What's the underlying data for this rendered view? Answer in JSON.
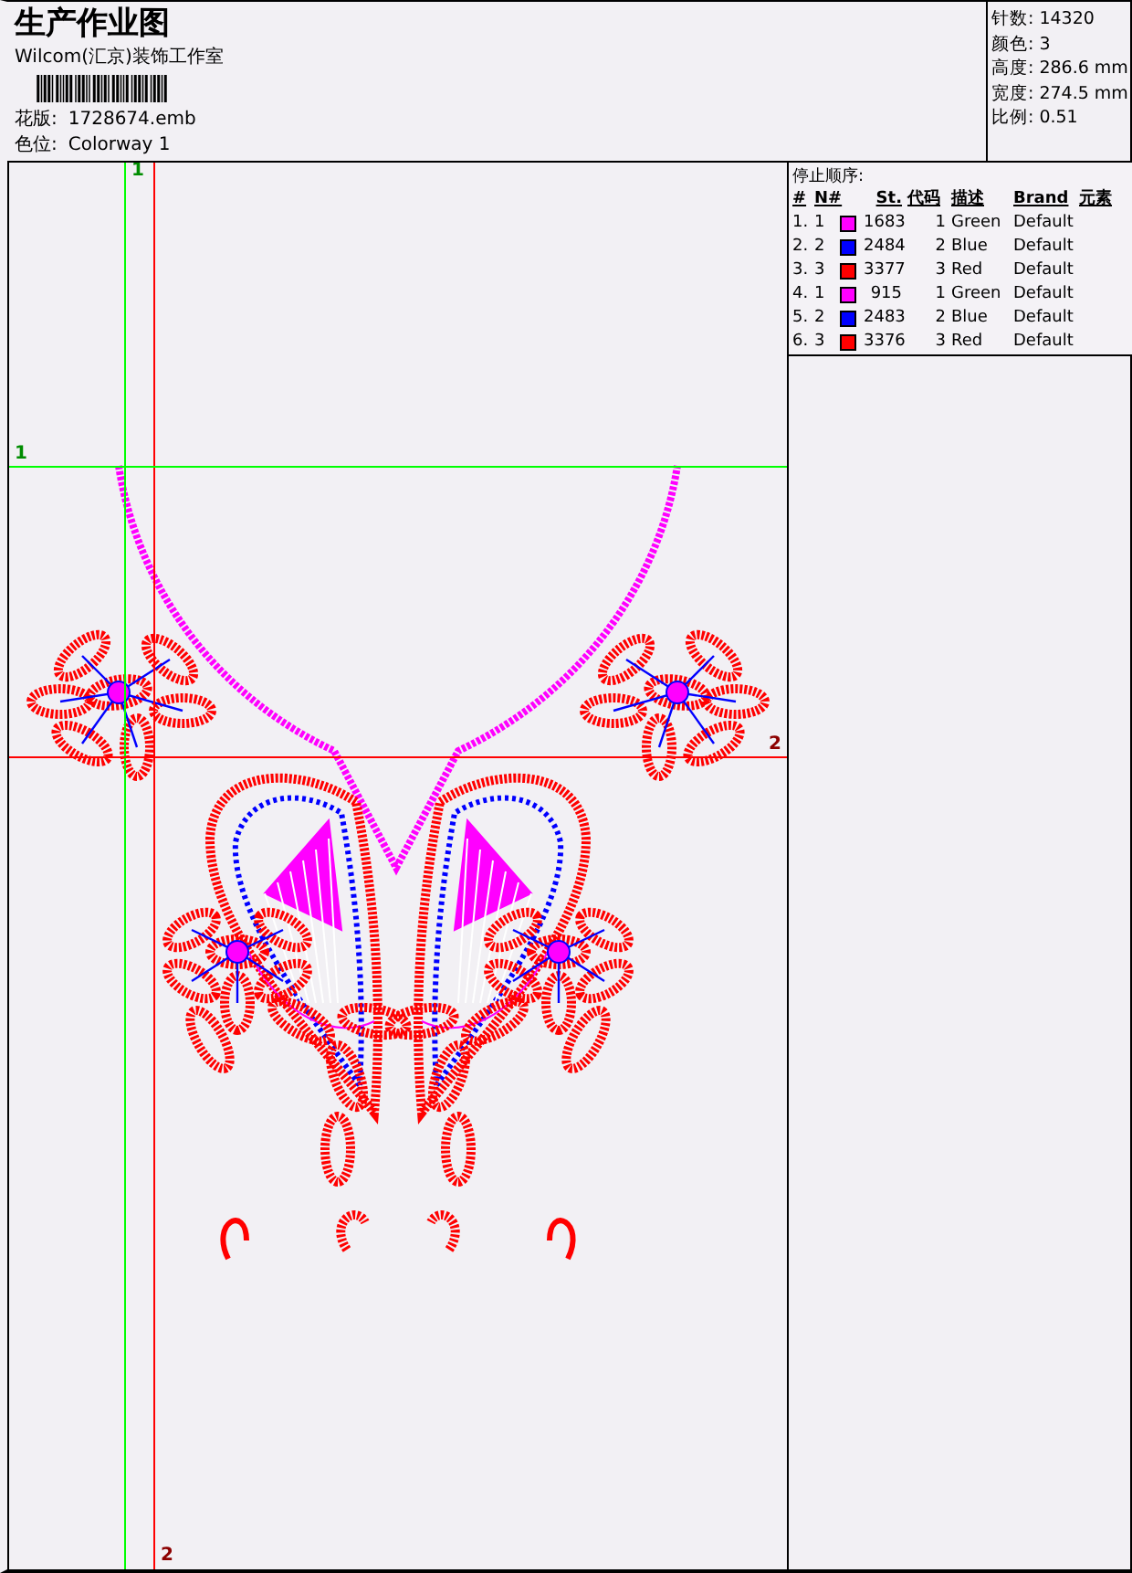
{
  "title": "生产作业图",
  "company": "Wilcom(汇京)装饰工作室",
  "design": {
    "label": "花版:",
    "value": "1728674.emb"
  },
  "colorway": {
    "label": "色位:",
    "value": "Colorway 1"
  },
  "stats": [
    {
      "label": "针数:",
      "value": "14320"
    },
    {
      "label": "颜色:",
      "value": "3"
    },
    {
      "label": "高度:",
      "value": "286.6 mm"
    },
    {
      "label": "宽度:",
      "value": "274.5 mm"
    },
    {
      "label": "比例:",
      "value": "0.51"
    }
  ],
  "stop_sequence": {
    "title": "停止顺序:",
    "columns": [
      "#",
      "N#",
      "St.",
      "代码",
      "描述",
      "Brand",
      "元素"
    ],
    "rows": [
      {
        "index": "1.",
        "n": "1",
        "color": "#ff00ff",
        "stitches": "1683",
        "code": "1",
        "description": "Green",
        "brand": "Default"
      },
      {
        "index": "2.",
        "n": "2",
        "color": "#0000ff",
        "stitches": "2484",
        "code": "2",
        "description": "Blue",
        "brand": "Default"
      },
      {
        "index": "3.",
        "n": "3",
        "color": "#ff0000",
        "stitches": "3377",
        "code": "3",
        "description": "Red",
        "brand": "Default"
      },
      {
        "index": "4.",
        "n": "1",
        "color": "#ff00ff",
        "stitches": "915",
        "code": "1",
        "description": "Green",
        "brand": "Default"
      },
      {
        "index": "5.",
        "n": "2",
        "color": "#0000ff",
        "stitches": "2483",
        "code": "2",
        "description": "Blue",
        "brand": "Default"
      },
      {
        "index": "6.",
        "n": "3",
        "color": "#ff0000",
        "stitches": "3376",
        "code": "3",
        "description": "Red",
        "brand": "Default"
      }
    ]
  },
  "guides": [
    {
      "kind": "vertical",
      "label": "1",
      "color": "#00ff00"
    },
    {
      "kind": "vertical",
      "label": "2",
      "color": "#ff0000"
    },
    {
      "kind": "horizontal",
      "label": "1",
      "color": "#00ff00"
    },
    {
      "kind": "horizontal",
      "label": "2",
      "color": "#ff0000"
    }
  ]
}
